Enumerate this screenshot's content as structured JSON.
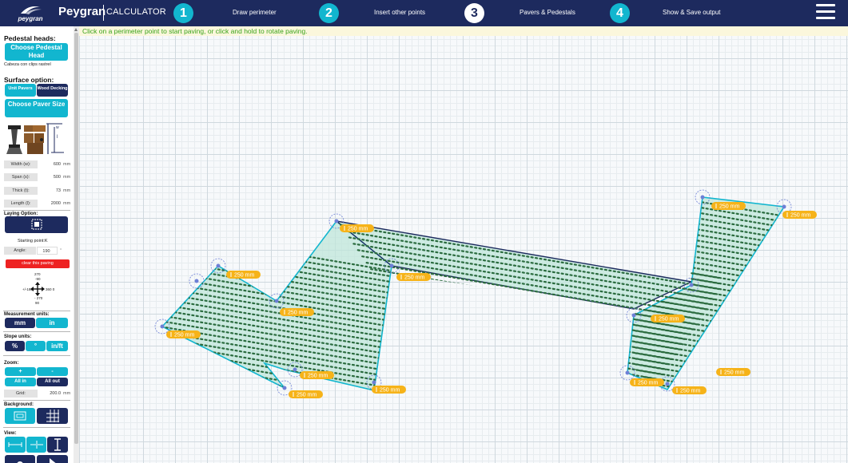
{
  "header": {
    "logo_text": "peygran",
    "brand": "Peygran",
    "brand_sub": "CALCULATOR",
    "steps": [
      {
        "num": "1",
        "label": "Draw perimeter"
      },
      {
        "num": "2",
        "label": "Insert other points"
      },
      {
        "num": "3",
        "label": "Pavers & Pedestals"
      },
      {
        "num": "4",
        "label": "Show & Save output"
      }
    ],
    "active_step": 3
  },
  "sidebar": {
    "pedestal_title": "Pedestal heads:",
    "choose_head_btn": "Choose Pedestal Head",
    "head_caption": "Cabeza con clips rastrel",
    "surface_title": "Surface option:",
    "unit_pavers": "Unit Pavers",
    "wood_decking": "Wood Decking",
    "choose_paver_btn": "Choose Paver Size",
    "dims": [
      {
        "label": "Width (w):",
        "value": "600",
        "unit": "mm"
      },
      {
        "label": "Span (s):",
        "value": "500",
        "unit": "mm"
      },
      {
        "label": "Thick (t):",
        "value": "73",
        "unit": "mm"
      },
      {
        "label": "Length (l):",
        "value": "2000",
        "unit": "mm"
      }
    ],
    "laying_title": "Laying Option:",
    "starting_point": "Starting point:K",
    "angle_label": "Angle:",
    "angle_value": "190",
    "clear_btn": "clear this paving",
    "compass": {
      "top1": "270",
      "top2": "-90",
      "left": "+/-180",
      "right": "360  0",
      "bottom1": "- 270",
      "bottom2": "90"
    },
    "measure_title": "Measurement units:",
    "mm": "mm",
    "in": "in",
    "slope_title": "Slope units:",
    "pct": "%",
    "deg": "°",
    "inft": "in/ft",
    "zoom_title": "Zoom:",
    "zoom_plus": "+",
    "zoom_minus": "-",
    "all_in": "All in",
    "all_out": "All out",
    "grid_label": "Grid:",
    "grid_value": "200.0",
    "grid_unit": "mm",
    "background_title": "Background:",
    "view_title": "View:"
  },
  "canvas": {
    "hint": "Click on a perimeter point to start paving, or click and hold to rotate paving.",
    "dim_labels": [
      "250 mm",
      "250 mm",
      "250 mm",
      "250 mm",
      "250 mm",
      "250 mm",
      "250 mm",
      "250 mm",
      "250 mm",
      "250 mm",
      "250 mm",
      "250 mm",
      "250 mm",
      "250 mm"
    ]
  },
  "colors": {
    "navy": "#1d2a5e",
    "cyan": "#12b6cf",
    "paving_fill": "#bfe6da",
    "outline": "#12b6cf",
    "dim_label": "#f6b319",
    "hint_text": "#3aa31c",
    "clear_btn": "#e22222"
  }
}
